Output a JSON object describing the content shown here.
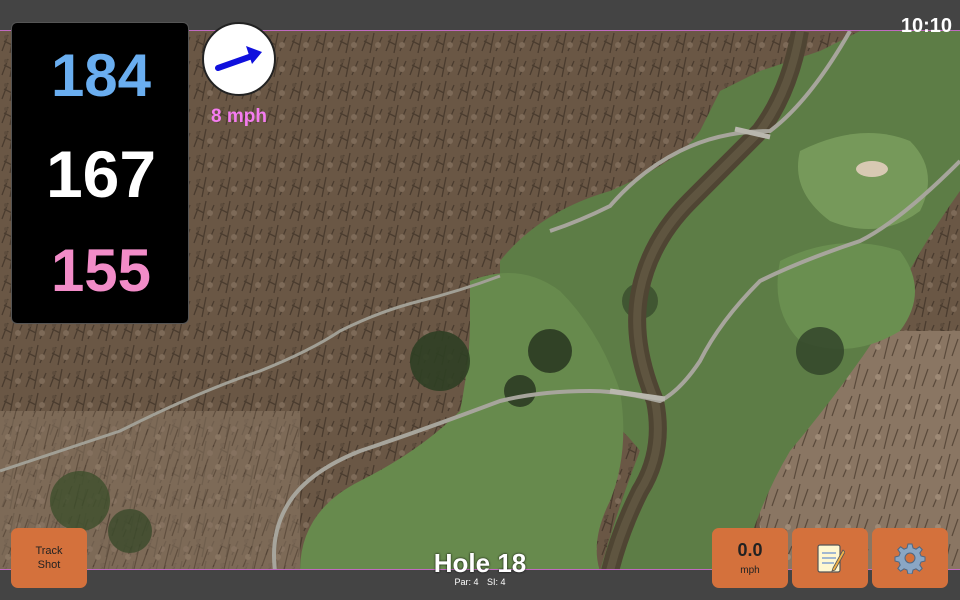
{
  "status": {
    "time": "10:10"
  },
  "yardages": {
    "back": "184",
    "middle": "167",
    "front": "155",
    "colors": {
      "back": "#6aaef0",
      "middle": "#ffffff",
      "front": "#f28cc8"
    }
  },
  "wind": {
    "speed_label": "8 mph",
    "icon": "wind-direction-arrow-icon",
    "label_color": "#f47cf0",
    "arrow_color": "#1010dd"
  },
  "hole": {
    "title": "Hole 18",
    "par": "Par: 4",
    "si": "SI: 4"
  },
  "buttons": {
    "track_shot_line1": "Track",
    "track_shot_line2": "Shot",
    "wind_value": "0.0",
    "wind_unit": "mph",
    "notes_icon": "notepad-icon",
    "settings_icon": "gear-icon",
    "color": "#d4713c"
  }
}
